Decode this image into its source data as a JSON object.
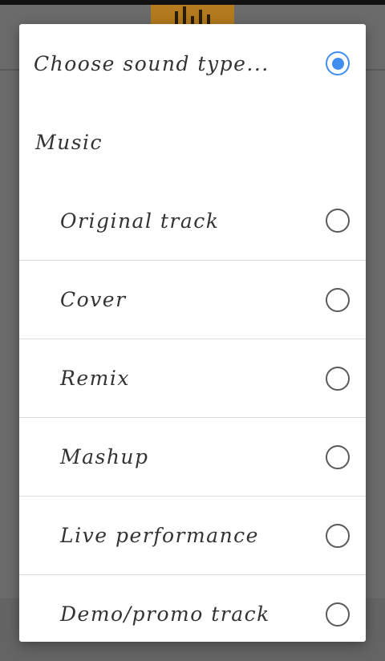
{
  "dialog": {
    "title": "Choose sound type...",
    "title_selected": true,
    "section_label": "Music",
    "options": [
      {
        "label": "Original track",
        "selected": false
      },
      {
        "label": "Cover",
        "selected": false
      },
      {
        "label": "Remix",
        "selected": false
      },
      {
        "label": "Mashup",
        "selected": false
      },
      {
        "label": "Live performance",
        "selected": false
      },
      {
        "label": "Demo/promo track",
        "selected": false
      }
    ]
  },
  "colors": {
    "accent": "#3f8ef0",
    "scrim": "#6b6b6b",
    "app_logo": "#b37a1e"
  }
}
